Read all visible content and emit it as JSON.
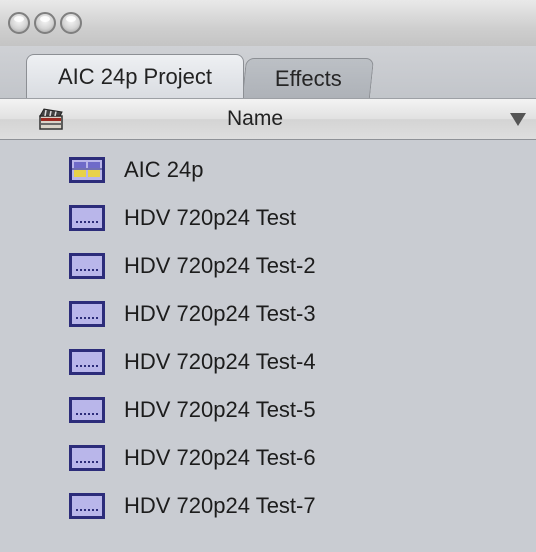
{
  "window": {
    "buttons": [
      "close",
      "minimize",
      "zoom"
    ]
  },
  "tabs": [
    {
      "label": "AIC 24p Project",
      "active": true
    },
    {
      "label": "Effects",
      "active": false
    }
  ],
  "header": {
    "column_label": "Name",
    "left_icon": "clapperboard-icon",
    "sort_icon": "triangle-down-icon"
  },
  "items": [
    {
      "label": "AIC 24p",
      "icon": "sequence-icon-color"
    },
    {
      "label": "HDV 720p24 Test",
      "icon": "sequence-icon"
    },
    {
      "label": "HDV 720p24 Test-2",
      "icon": "sequence-icon"
    },
    {
      "label": "HDV 720p24 Test-3",
      "icon": "sequence-icon"
    },
    {
      "label": "HDV 720p24 Test-4",
      "icon": "sequence-icon"
    },
    {
      "label": "HDV 720p24 Test-5",
      "icon": "sequence-icon"
    },
    {
      "label": "HDV 720p24 Test-6",
      "icon": "sequence-icon"
    },
    {
      "label": "HDV 720p24 Test-7",
      "icon": "sequence-icon"
    }
  ],
  "colors": {
    "background": "#c9ccd2",
    "icon_fill": "#b9b6ea",
    "icon_border": "#2c2c7a",
    "icon_accent_yellow": "#e8d24a"
  }
}
